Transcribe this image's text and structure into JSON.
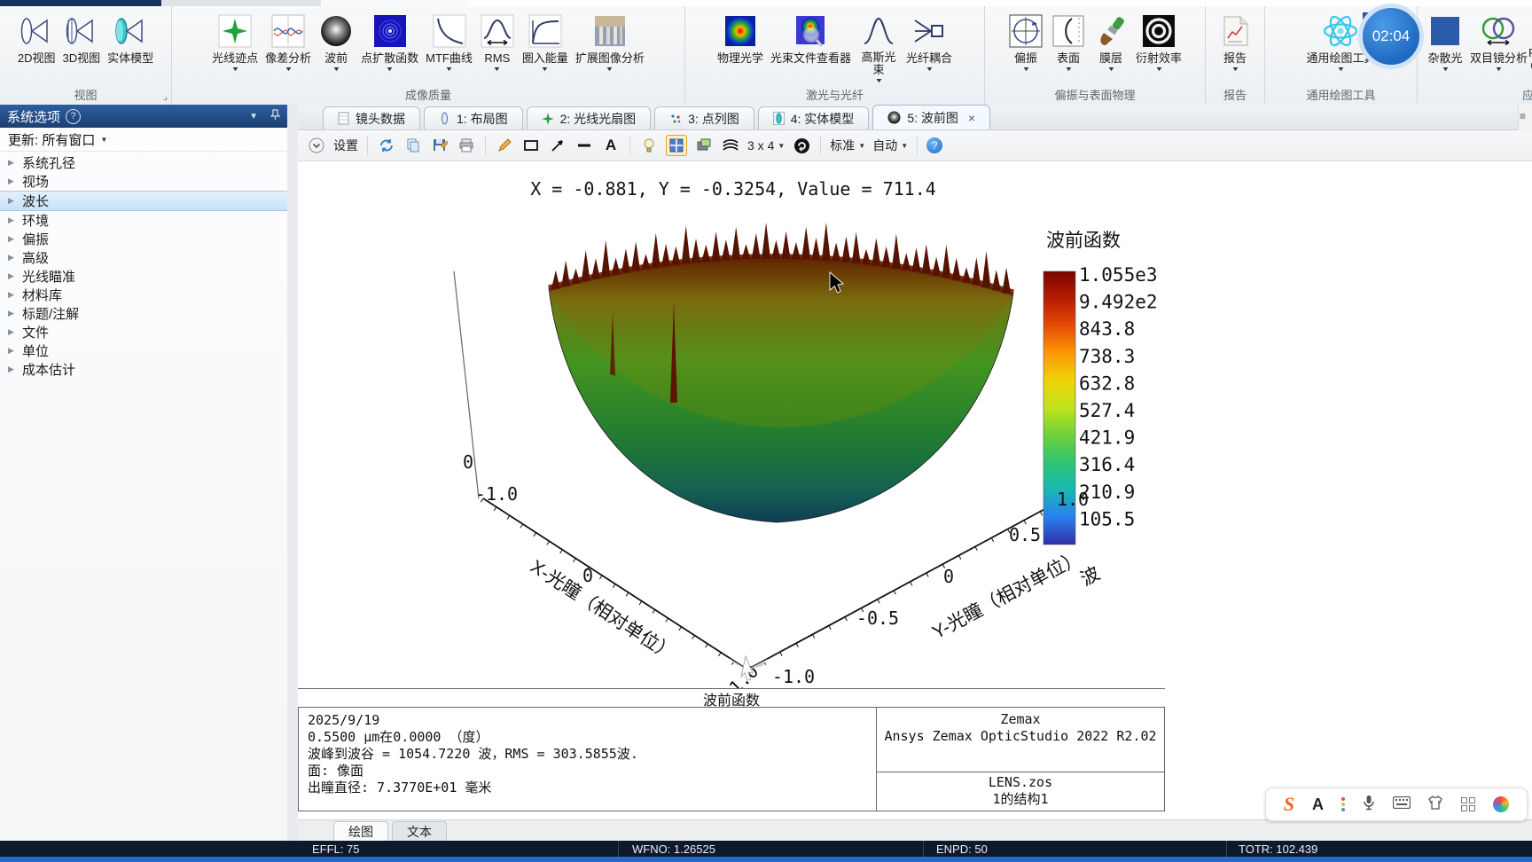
{
  "app": {
    "clock": "02:04"
  },
  "icons": {
    "dropdown": "▼",
    "tree_expand": "▶",
    "help": "?",
    "close": "×",
    "window_menu": "≡",
    "settings_chevron": "ˇ",
    "launcher": "⌟",
    "overflow": "F",
    "overflow_arrow": "▶"
  },
  "ribbon": {
    "groups": [
      {
        "label": "视图",
        "items": [
          {
            "label": "2D视图"
          },
          {
            "label": "3D视图"
          },
          {
            "label": "实体模型"
          }
        ]
      },
      {
        "label": "成像质量",
        "items": [
          {
            "label": "光线迹点"
          },
          {
            "label": "像差分析"
          },
          {
            "label": "波前"
          },
          {
            "label": "点扩散函数"
          },
          {
            "label": "MTF曲线"
          },
          {
            "label": "RMS"
          },
          {
            "label": "圈入能量"
          },
          {
            "label": "扩展图像分析"
          }
        ]
      },
      {
        "label": "激光与光纤",
        "items": [
          {
            "label": "物理光学"
          },
          {
            "label": "光束文件查看器"
          },
          {
            "label": "高斯光束"
          },
          {
            "label": "光纤耦合"
          }
        ]
      },
      {
        "label": "偏振与表面物理",
        "items": [
          {
            "label": "偏振"
          },
          {
            "label": "表面"
          },
          {
            "label": "膜层"
          },
          {
            "label": "衍射效率"
          }
        ]
      },
      {
        "label": "报告",
        "items": [
          {
            "label": "报告"
          }
        ]
      },
      {
        "label": "通用绘图工具",
        "items": [
          {
            "label": "通用绘图工具"
          }
        ]
      },
      {
        "label": "应",
        "items": [
          {
            "label": "杂散光"
          },
          {
            "label": "双目镜分析"
          }
        ]
      }
    ]
  },
  "sidebar": {
    "title": "系统选项",
    "update_label": "更新: 所有窗口",
    "items": [
      {
        "label": "系统孔径"
      },
      {
        "label": "视场"
      },
      {
        "label": "波长",
        "selected": true
      },
      {
        "label": "环境"
      },
      {
        "label": "偏振"
      },
      {
        "label": "高级"
      },
      {
        "label": "光线瞄准"
      },
      {
        "label": "材料库"
      },
      {
        "label": "标题/注解"
      },
      {
        "label": "文件"
      },
      {
        "label": "单位"
      },
      {
        "label": "成本估计"
      }
    ]
  },
  "tabs": [
    {
      "label": "镜头数据"
    },
    {
      "label": "1: 布局图"
    },
    {
      "label": "2: 光线光扇图"
    },
    {
      "label": "3: 点列图"
    },
    {
      "label": "4: 实体模型"
    },
    {
      "label": "5: 波前图",
      "active": true
    }
  ],
  "plot_toolbar": {
    "settings": "设置",
    "grid": "3 x 4",
    "standard": "标准",
    "auto": "自动"
  },
  "chart_data": {
    "type": "surface3d",
    "title": "波前函数",
    "readout": "X = -0.881, Y = -0.3254, Value = 711.4",
    "xlabel": "X-光瞳（相对单位）",
    "ylabel": "Y-光瞳（相对单位）",
    "zlabel": "波",
    "x_ticks": [
      "-1.0",
      "0",
      "1.0"
    ],
    "y_ticks": [
      "-1.0",
      "-0.5",
      "0",
      "0.5",
      "1.0"
    ],
    "z_ticks": [
      "0"
    ],
    "value_range": [
      0,
      1054.722
    ],
    "surface_summary": {
      "peak_to_valley_waves": 1054.722,
      "rms_waves": 303.5855
    },
    "colorbar": {
      "title": "波前函数",
      "labels": [
        "1.055e3",
        "9.492e2",
        "843.8",
        "738.3",
        "632.8",
        "527.4",
        "421.9",
        "316.4",
        "210.9",
        "105.5"
      ],
      "colors_top_to_bottom": [
        "#7a0403",
        "#b71c01",
        "#e84c05",
        "#fb9906",
        "#f0d308",
        "#bfe31c",
        "#6fd13c",
        "#2fc474",
        "#17b8b4",
        "#2a7ff0",
        "#2f2fa8"
      ]
    },
    "footer_title": "波前函数"
  },
  "info_panel": {
    "date": "2025/9/19",
    "line_wavelength": "0.5500 μm在0.0000 （度）",
    "line_pv": "波峰到波谷 = 1054.7220 波，RMS = 303.5855波.",
    "line_surface": "面: 像面",
    "line_exit_pupil": "出瞳直径: 7.3770E+01 毫米",
    "brand_line1": "Zemax",
    "brand_line2": "Ansys Zemax OpticStudio 2022 R2.02",
    "file_name": "LENS.zos",
    "config": "1的结构1"
  },
  "bottom_tabs": [
    {
      "label": "绘图",
      "active": true
    },
    {
      "label": "文本"
    }
  ],
  "status_bar": {
    "effl": "EFFL: 75",
    "wfno": "WFNO: 1.26525",
    "enpd": "ENPD: 50",
    "totr": "TOTR: 102.439"
  }
}
